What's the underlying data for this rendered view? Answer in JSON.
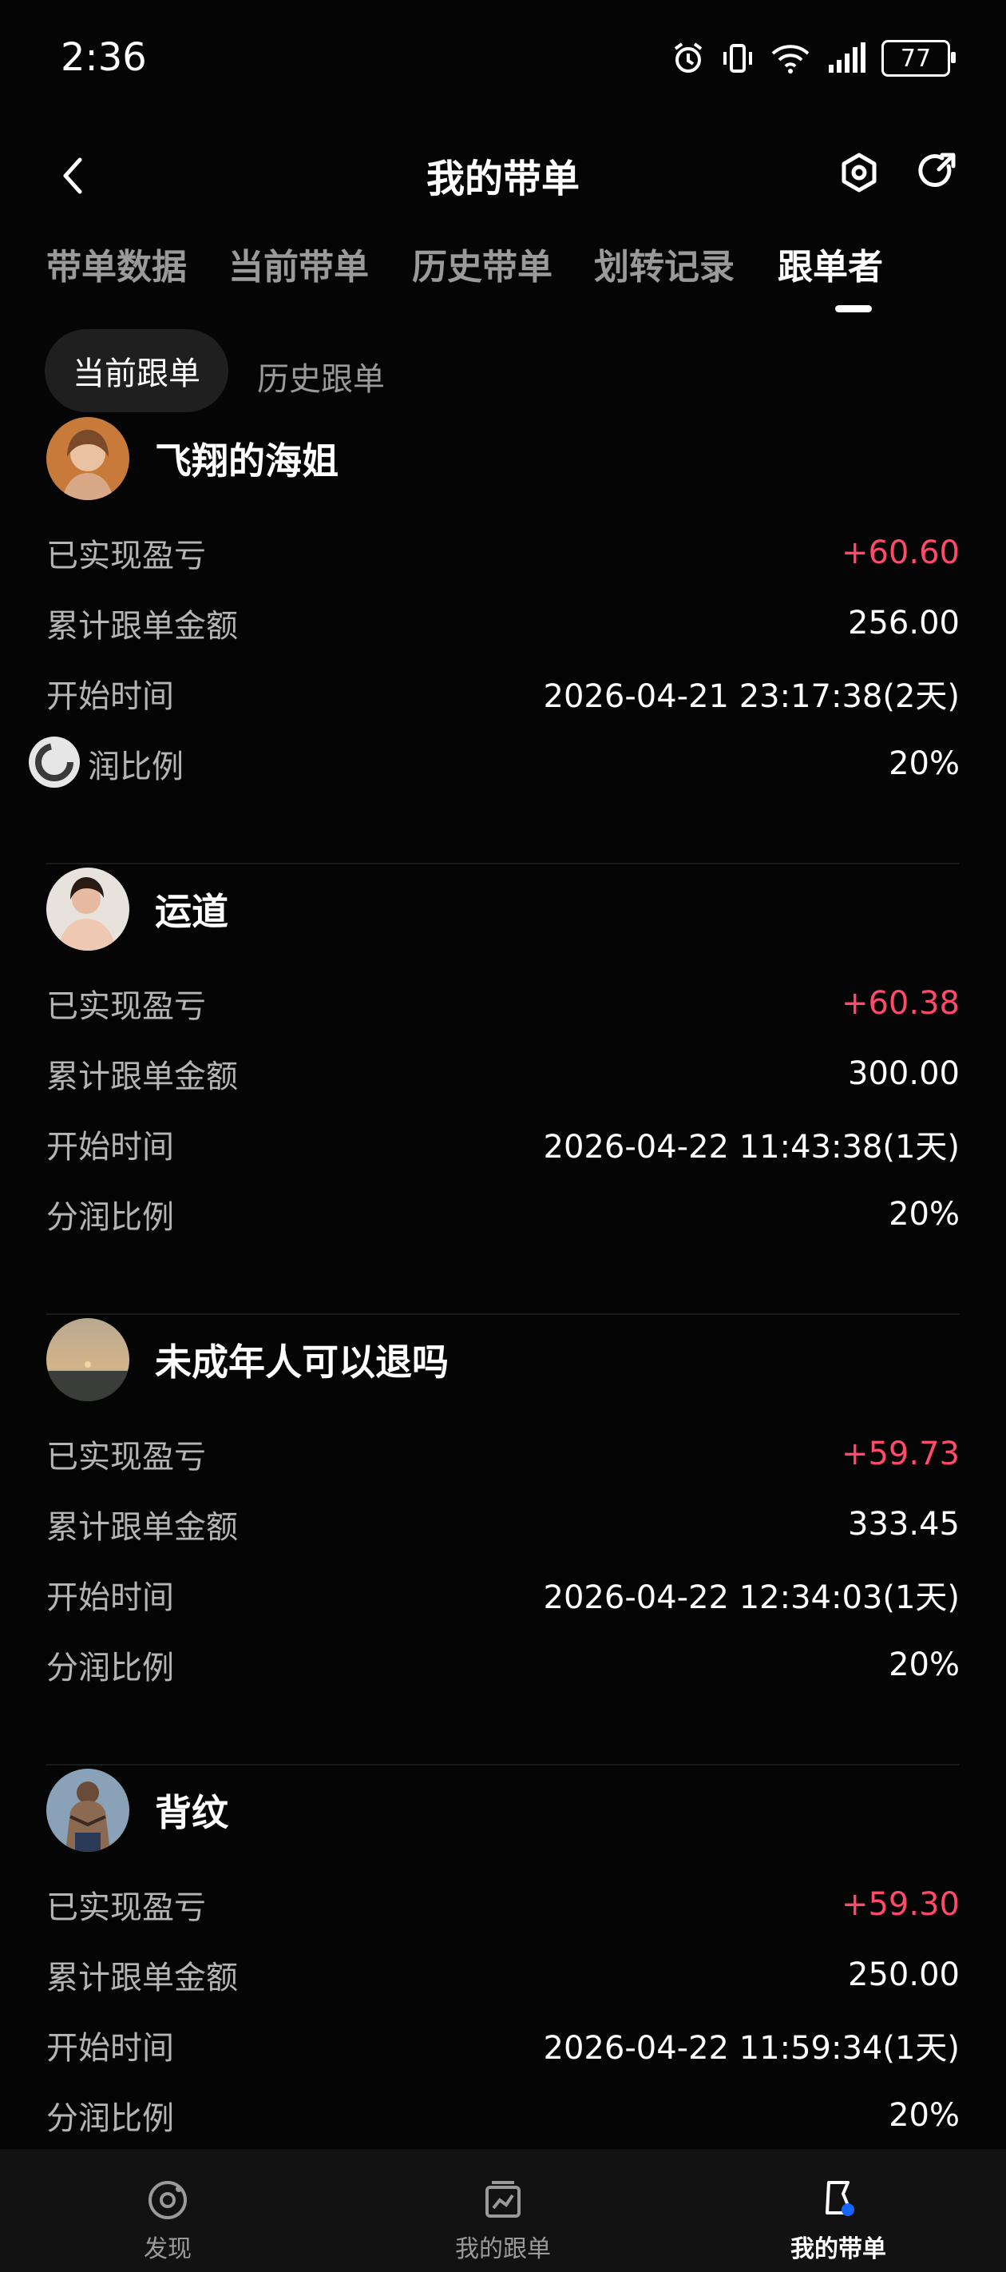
{
  "status_bar": {
    "time": "2:36",
    "battery": "77"
  },
  "header": {
    "title": "我的带单"
  },
  "tabs": [
    {
      "label": "带单数据"
    },
    {
      "label": "当前带单"
    },
    {
      "label": "历史带单"
    },
    {
      "label": "划转记录"
    },
    {
      "label": "跟单者",
      "active": true
    }
  ],
  "subtabs": {
    "current": "当前跟单",
    "history": "历史跟单"
  },
  "followers": [
    {
      "name": "飞翔的海姐",
      "pnl_label": "已实现盈亏",
      "pnl": "+60.60",
      "amount_label": "累计跟单金额",
      "amount": "256.00",
      "start_label": "开始时间",
      "start": "2026-04-21 23:17:38(2天)",
      "ratio_label": "润比例",
      "ratio": "20%"
    },
    {
      "name": "运道",
      "pnl_label": "已实现盈亏",
      "pnl": "+60.38",
      "amount_label": "累计跟单金额",
      "amount": "300.00",
      "start_label": "开始时间",
      "start": "2026-04-22 11:43:38(1天)",
      "ratio_label": "分润比例",
      "ratio": "20%"
    },
    {
      "name": "未成年人可以退吗",
      "pnl_label": "已实现盈亏",
      "pnl": "+59.73",
      "amount_label": "累计跟单金额",
      "amount": "333.45",
      "start_label": "开始时间",
      "start": "2026-04-22 12:34:03(1天)",
      "ratio_label": "分润比例",
      "ratio": "20%"
    },
    {
      "name": "背纹",
      "pnl_label": "已实现盈亏",
      "pnl": "+59.30",
      "amount_label": "累计跟单金额",
      "amount": "250.00",
      "start_label": "开始时间",
      "start": "2026-04-22 11:59:34(1天)",
      "ratio_label": "分润比例",
      "ratio": "20%"
    }
  ],
  "bottom_nav": [
    {
      "label": "发现",
      "icon": "discover-icon"
    },
    {
      "label": "我的跟单",
      "icon": "chart-board-icon"
    },
    {
      "label": "我的带单",
      "icon": "leader-flag-icon",
      "active": true
    }
  ],
  "colors": {
    "profit": "#ff4a6a",
    "background": "#050505"
  }
}
